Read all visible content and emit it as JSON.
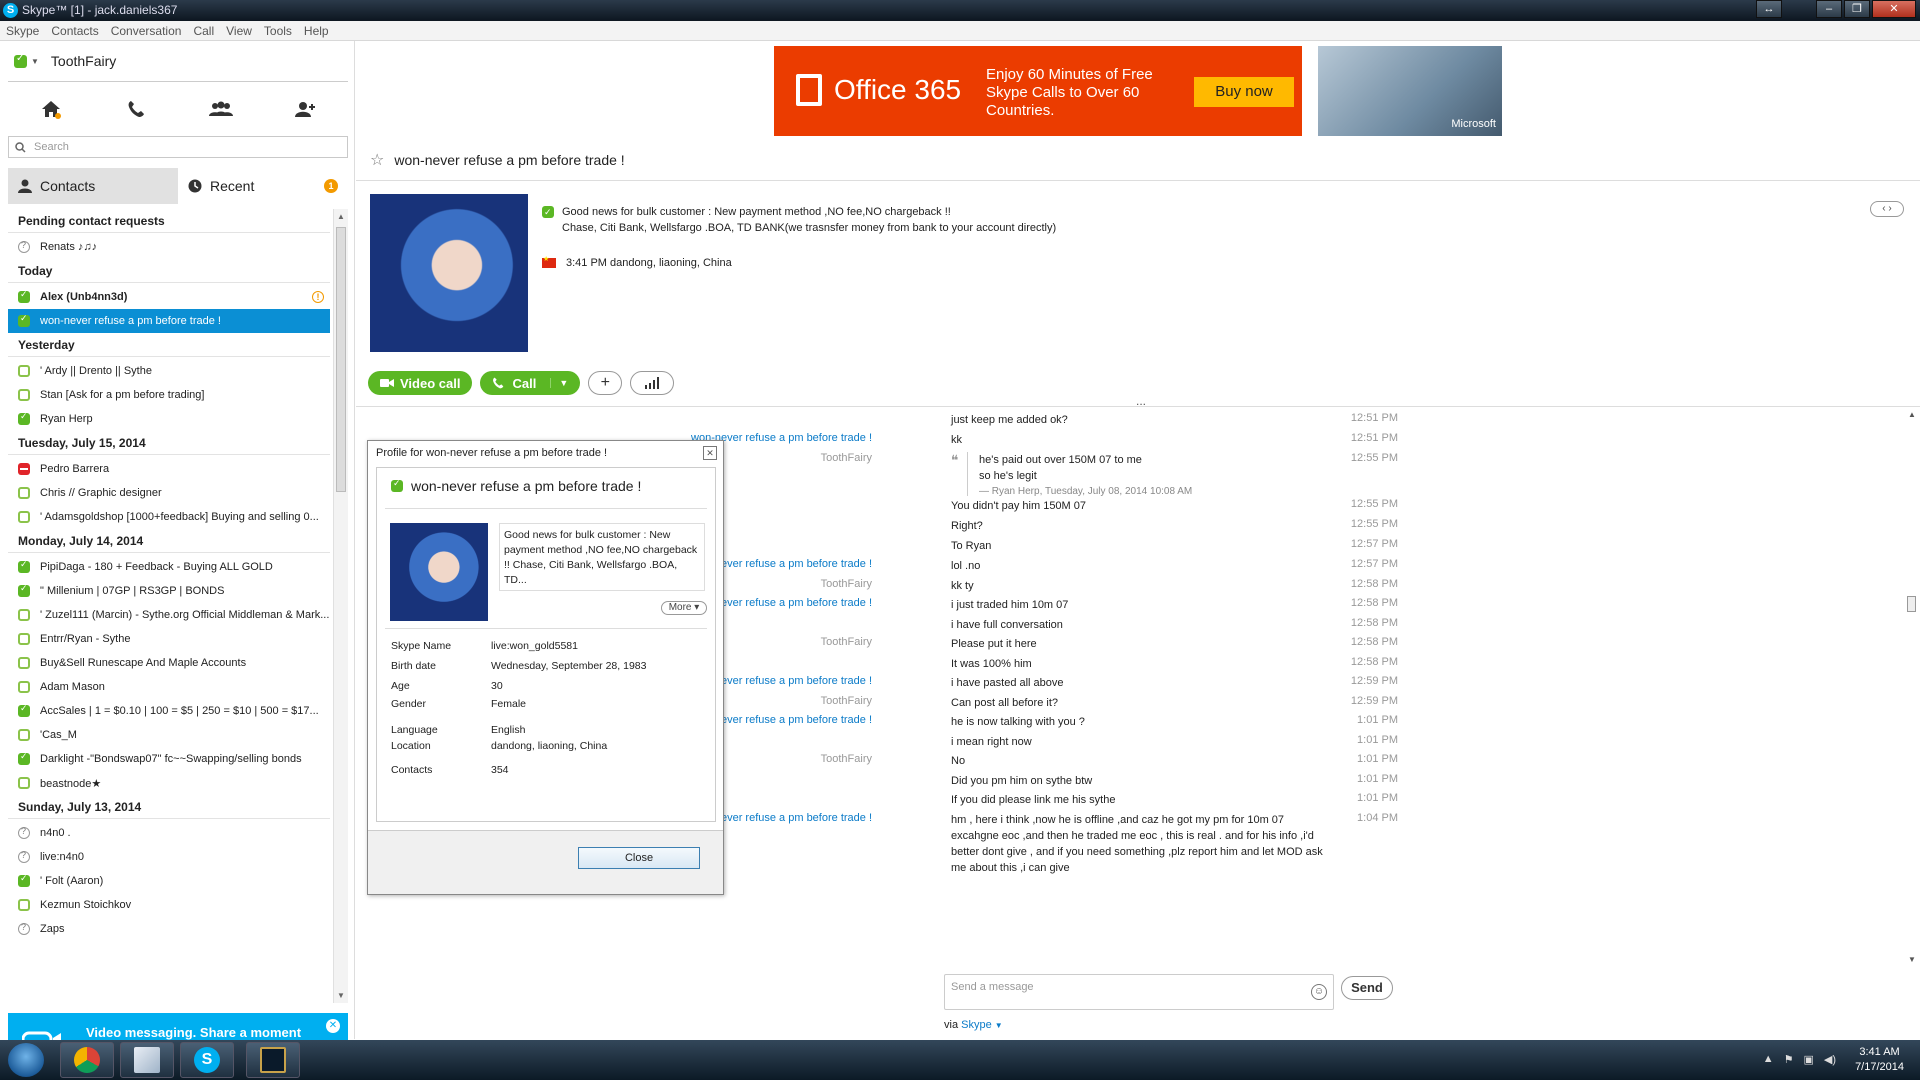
{
  "window": {
    "title": "Skype™ [1] - jack.daniels367"
  },
  "menu": [
    "Skype",
    "Contacts",
    "Conversation",
    "Call",
    "View",
    "Tools",
    "Help"
  ],
  "user": {
    "name": "ToothFairy"
  },
  "search": {
    "placeholder": "Search"
  },
  "tabs": {
    "contacts": "Contacts",
    "recent": "Recent",
    "recent_badge": "1"
  },
  "groups": [
    {
      "title": "Pending contact requests",
      "items": [
        {
          "status": "unknown",
          "name": "Renats ♪♫♪"
        }
      ]
    },
    {
      "title": "Today",
      "items": [
        {
          "status": "online",
          "name": "Alex (Unb4nn3d)",
          "bold": true,
          "warn": true
        },
        {
          "status": "online",
          "name": "won-never refuse a pm before trade !",
          "selected": true
        }
      ]
    },
    {
      "title": "Yesterday",
      "items": [
        {
          "status": "offline",
          "name": "' Ardy || Drento || Sythe"
        },
        {
          "status": "offline",
          "name": "Stan [Ask for a pm before trading]"
        },
        {
          "status": "online",
          "name": "Ryan Herp"
        }
      ]
    },
    {
      "title": "Tuesday, July 15, 2014",
      "items": [
        {
          "status": "dnd",
          "name": "Pedro Barrera"
        },
        {
          "status": "offline",
          "name": "Chris // Graphic designer"
        },
        {
          "status": "offline",
          "name": "'     Adamsgoldshop [1000+feedback] Buying and selling 0..."
        }
      ]
    },
    {
      "title": "Monday, July 14, 2014",
      "items": [
        {
          "status": "online",
          "name": "PipiDaga - 180 + Feedback - Buying ALL GOLD"
        },
        {
          "status": "online",
          "name": "\"  Millenium | 07GP | RS3GP | BONDS"
        },
        {
          "status": "offline",
          "name": "' Zuzel111 (Marcin) - Sythe.org Official Middleman & Mark..."
        },
        {
          "status": "offline",
          "name": "Entrr/Ryan - Sythe"
        },
        {
          "status": "offline",
          "name": "Buy&Sell  Runescape And Maple Accounts"
        },
        {
          "status": "offline",
          "name": "Adam Mason"
        },
        {
          "status": "online",
          "name": "AccSales | 1 = $0.10 | 100 = $5 | 250 = $10 | 500 = $17..."
        },
        {
          "status": "offline",
          "name": "'Cas_M"
        },
        {
          "status": "online",
          "name": "Darklight -\"Bondswap07\" fc~~Swapping/selling bonds"
        },
        {
          "status": "offline",
          "name": "beastnode★"
        }
      ]
    },
    {
      "title": "Sunday, July 13, 2014",
      "items": [
        {
          "status": "unknown",
          "name": "n4n0 ."
        },
        {
          "status": "unknown",
          "name": "live:n4n0"
        },
        {
          "status": "online",
          "name": "' Folt (Aaron)"
        },
        {
          "status": "offline",
          "name": "Kezmun Stoichkov"
        },
        {
          "status": "unknown",
          "name": "Zaps"
        }
      ]
    }
  ],
  "promo": {
    "text": "Video messaging. Share a moment people can see, hear and feel."
  },
  "ad": {
    "brand": "Office 365",
    "text": "Enjoy 60 Minutes of Free Skype Calls to Over 60 Countries.",
    "cta": "Buy now",
    "sponsor": "Microsoft"
  },
  "conversation": {
    "title": "won-never refuse a pm before trade !",
    "mood_line1": "Good news for bulk customer : New payment method ,NO fee,NO chargeback !!",
    "mood_line2": "Chase, Citi Bank, Wellsfargo .BOA, TD BANK(we trasnsfer money from bank to your account directly)",
    "local_time": "3:41 PM dandong, liaoning, China",
    "video_call": "Video call",
    "call": "Call"
  },
  "messages": [
    {
      "who": "",
      "me": false,
      "text": "just keep me added ok?",
      "time": "12:51 PM"
    },
    {
      "who": "won-never refuse a pm before trade !",
      "me": false,
      "text": "kk",
      "time": "12:51 PM"
    },
    {
      "who": "ToothFairy",
      "me": true,
      "quote": true,
      "text": "he's paid out over 150M 07 to me",
      "text2": "so he's legit",
      "src": "— Ryan Herp, Tuesday, July 08, 2014 10:08 AM",
      "time": "12:55 PM"
    },
    {
      "who": "",
      "me": true,
      "text": "You didn't pay him 150M 07",
      "time": "12:55 PM"
    },
    {
      "who": "",
      "me": true,
      "text": "Right?",
      "time": "12:55 PM"
    },
    {
      "who": "",
      "me": true,
      "text": "To Ryan",
      "time": "12:57 PM"
    },
    {
      "who": "won-never refuse a pm before trade !",
      "me": false,
      "text": "lol .no",
      "time": "12:57 PM"
    },
    {
      "who": "ToothFairy",
      "me": true,
      "text": "kk ty",
      "time": "12:58 PM"
    },
    {
      "who": "won-never refuse a pm before trade !",
      "me": false,
      "text": "i just traded him  10m  07",
      "time": "12:58 PM"
    },
    {
      "who": "",
      "me": false,
      "text": "i have full conversation",
      "time": "12:58 PM"
    },
    {
      "who": "ToothFairy",
      "me": true,
      "text": "Please put it here",
      "time": "12:58 PM"
    },
    {
      "who": "",
      "me": true,
      "text": "It was 100% him",
      "time": "12:58 PM"
    },
    {
      "who": "won-never refuse a pm before trade !",
      "me": false,
      "text": "i have pasted all above",
      "time": "12:59 PM"
    },
    {
      "who": "ToothFairy",
      "me": true,
      "text": "Can post all before it?",
      "time": "12:59 PM"
    },
    {
      "who": "won-never refuse a pm before trade !",
      "me": false,
      "text": "he is now talking with you ?",
      "time": "1:01 PM"
    },
    {
      "who": "",
      "me": false,
      "text": "i mean right now",
      "time": "1:01 PM"
    },
    {
      "who": "ToothFairy",
      "me": true,
      "text": "No",
      "time": "1:01 PM"
    },
    {
      "who": "",
      "me": true,
      "text": "Did you pm him on sythe btw",
      "time": "1:01 PM"
    },
    {
      "who": "",
      "me": true,
      "text": "If you did please link me his sythe",
      "time": "1:01 PM"
    },
    {
      "who": "won-never refuse a pm before trade !",
      "me": false,
      "text": "hm , here i think ,now he is offline ,and caz he got my pm for  10m 07 excahgne eoc ,and then he traded me eoc , this is real .  and for his info ,i'd better dont give , and if you need something ,plz report him and let MOD ask me about this ,i can give",
      "time": "1:04 PM"
    }
  ],
  "compose": {
    "placeholder": "Send a message",
    "send": "Send",
    "via_label": "via",
    "via_link": "Skype"
  },
  "profile": {
    "dialog_title": "Profile for won-never refuse a pm before trade !",
    "name": "won-never refuse a pm before trade !",
    "mood": "Good news for bulk customer : New payment method ,NO fee,NO chargeback !! Chase, Citi Bank, Wellsfargo .BOA, TD...",
    "more": "More",
    "fields": [
      {
        "k": "Skype Name",
        "v": "live:won_gold5581"
      },
      {
        "k": "Birth date",
        "v": "Wednesday, September 28, 1983"
      },
      {
        "k": "Age",
        "v": "30"
      },
      {
        "k": "Gender",
        "v": "Female"
      },
      {
        "k": "Language",
        "v": "English"
      },
      {
        "k": "Location",
        "v": "dandong, liaoning, China"
      },
      {
        "k": "Contacts",
        "v": "354"
      }
    ],
    "close": "Close"
  },
  "taskbar": {
    "time": "3:41 AM",
    "date": "7/17/2014"
  }
}
